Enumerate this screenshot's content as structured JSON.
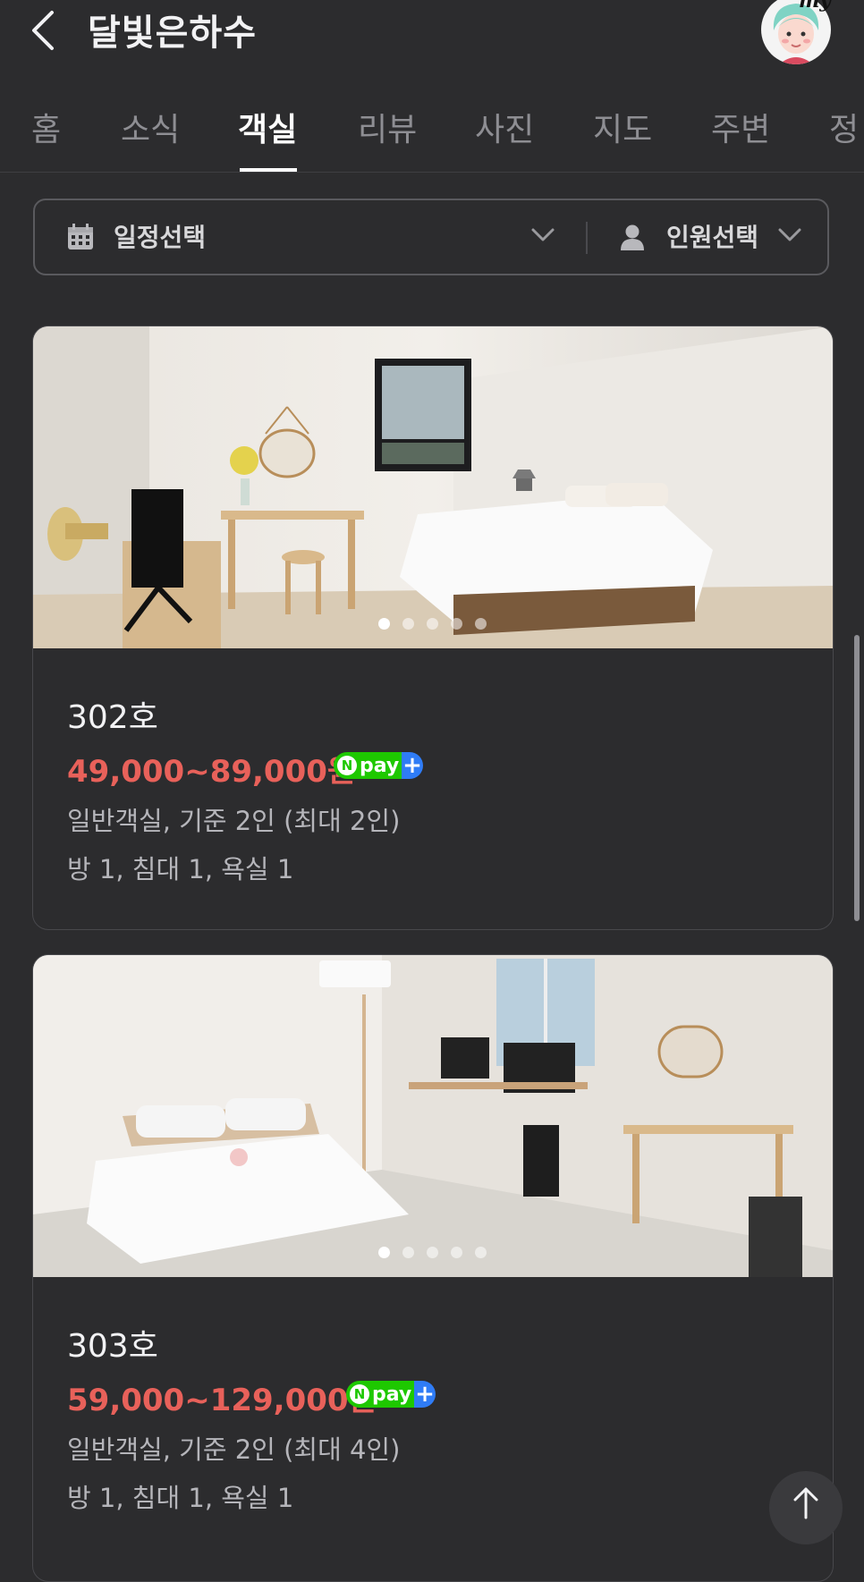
{
  "header": {
    "title": "달빛은하수",
    "avatar_label": "my"
  },
  "tabs": [
    {
      "label": "홈"
    },
    {
      "label": "소식"
    },
    {
      "label": "객실"
    },
    {
      "label": "리뷰"
    },
    {
      "label": "사진"
    },
    {
      "label": "지도"
    },
    {
      "label": "주변"
    },
    {
      "label": "정"
    }
  ],
  "active_tab": "객실",
  "filter": {
    "date_label": "일정선택",
    "guest_label": "인원선택"
  },
  "rooms": [
    {
      "name": "302호",
      "price": "49,000~89,000원",
      "pay_badge": "pay",
      "type": "일반객실, 기준 2인 (최대 2인)",
      "layout": "방 1, 침대 1, 욕실 1",
      "photo_count": 5,
      "photo_index": 1
    },
    {
      "name": "303호",
      "price": "59,000~129,000원",
      "pay_badge": "pay",
      "type": "일반객실, 기준 2인 (최대 4인)",
      "layout": "방 1, 침대 1, 욕실 1",
      "photo_count": 5,
      "photo_index": 1
    }
  ],
  "colors": {
    "background": "#2c2c2e",
    "price": "#e8615a",
    "npay_green": "#1ec800",
    "npay_blue": "#2f7cf6"
  }
}
